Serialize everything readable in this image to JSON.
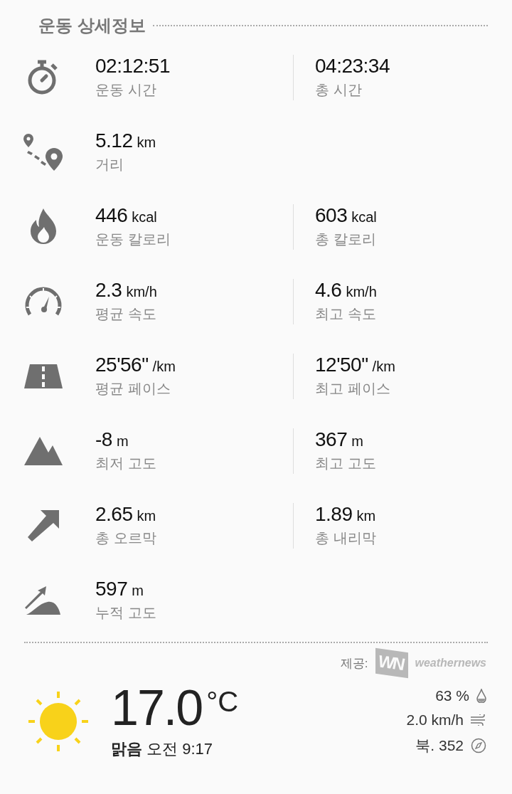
{
  "title": "운동 상세정보",
  "rows": [
    {
      "kind": "stopwatch",
      "stats": [
        {
          "value": "02:12:51",
          "label": "운동 시간"
        },
        {
          "value": "04:23:34",
          "label": "총 시간"
        }
      ]
    },
    {
      "kind": "route",
      "stats": [
        {
          "value": "5.12",
          "unit": "km",
          "label": "거리"
        }
      ]
    },
    {
      "kind": "flame",
      "stats": [
        {
          "value": "446",
          "unit": "kcal",
          "label": "운동 칼로리"
        },
        {
          "value": "603",
          "unit": "kcal",
          "label": "총 칼로리"
        }
      ]
    },
    {
      "kind": "speedometer",
      "stats": [
        {
          "value": "2.3",
          "unit": "km/h",
          "label": "평균 속도"
        },
        {
          "value": "4.6",
          "unit": "km/h",
          "label": "최고 속도"
        }
      ]
    },
    {
      "kind": "road",
      "stats": [
        {
          "value": "25'56\"",
          "unit": "/km",
          "label": "평균 페이스"
        },
        {
          "value": "12'50\"",
          "unit": "/km",
          "label": "최고 페이스"
        }
      ]
    },
    {
      "kind": "mountains",
      "stats": [
        {
          "value": "-8",
          "unit": "m",
          "label": "최저 고도"
        },
        {
          "value": "367",
          "unit": "m",
          "label": "최고 고도"
        }
      ]
    },
    {
      "kind": "arrow",
      "stats": [
        {
          "value": "2.65",
          "unit": "km",
          "label": "총 오르막"
        },
        {
          "value": "1.89",
          "unit": "km",
          "label": "총 내리막"
        }
      ]
    },
    {
      "kind": "climb",
      "stats": [
        {
          "value": "597",
          "unit": "m",
          "label": "누적 고도"
        }
      ]
    }
  ],
  "weather": {
    "provider_label": "제공:",
    "logo_text": "WN",
    "provider": "weathernews",
    "kind": "sunny",
    "temperature": "17.0",
    "temp_unit": "°C",
    "summary": "**맑음** 오전 9:17",
    "details": [
      {
        "kind": "humidity",
        "text": "63 %"
      },
      {
        "kind": "wind",
        "text": "2.0 km/h"
      },
      {
        "kind": "direction",
        "text": "북. 352"
      }
    ]
  }
}
